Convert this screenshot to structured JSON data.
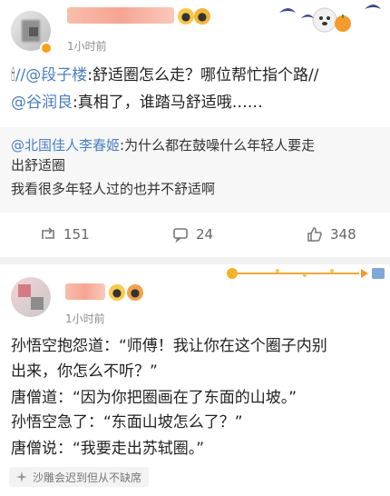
{
  "post1": {
    "time": "1小时前",
    "line1": {
      "mention": "//@段子楼",
      "text": ":舒适圈怎么走？哪位帮忙指个路//"
    },
    "line2": {
      "mention": "@谷润良",
      "text": ":真相了，谁踏马舒适哦……"
    },
    "quote": {
      "mention": "@北国佳人李春姬",
      "line1_text": ":为什么都在鼓噪什么年轻人要走",
      "line2_text": "出舒适圈",
      "line3_text": "我看很多年轻人过的也并不舒适啊"
    },
    "actions": {
      "repost": "151",
      "comment": "24",
      "like": "348"
    }
  },
  "post2": {
    "time": "1小时前",
    "lines": [
      "孙悟空抱怨道：“师傅！我让你在这个圈子内别",
      "出来，你怎么不听？”",
      "唐僧道：“因为你把圈画在了东面的山坡。”",
      "孙悟空急了：“东面山坡怎么了？”",
      "唐僧说：“我要走出苏轼圈。”"
    ],
    "footer": "沙雕会迟到但从不缺席"
  },
  "icons": {
    "repost": "repost-icon",
    "comment": "comment-icon",
    "like": "like-icon",
    "footer": "sparkle-icon"
  },
  "colors": {
    "mention": "#4a7fc1",
    "muted": "#8e8e8e",
    "quote_bg": "#f7f7f7",
    "separator": "#f2f2f2"
  }
}
